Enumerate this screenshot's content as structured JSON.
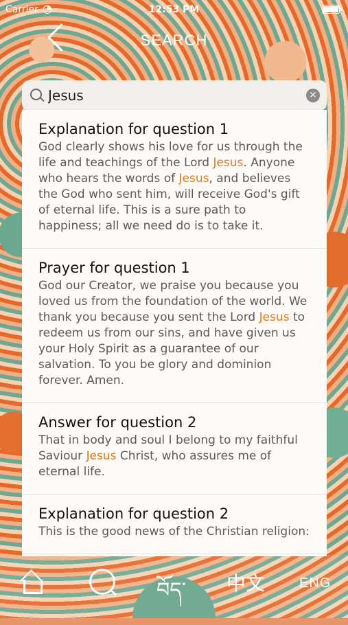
{
  "status_bar": {
    "carrier": "Carrier",
    "time": "12:53 PM"
  },
  "nav": {
    "title": "SEARCH"
  },
  "search": {
    "value": "Jesus",
    "placeholder": ""
  },
  "results": [
    {
      "title": "Explanation for question 1",
      "segments": [
        {
          "text": "God clearly shows his love for us through the life and teachings of the Lord ",
          "hl": false
        },
        {
          "text": "Jesus",
          "hl": true
        },
        {
          "text": ". Anyone who hears the words of ",
          "hl": false
        },
        {
          "text": "Jesus",
          "hl": true
        },
        {
          "text": ", and believes the God who sent him, will receive God's gift of eternal life. This is a sure path to happiness; all we need do is to take it.",
          "hl": false
        }
      ]
    },
    {
      "title": "Prayer for question 1",
      "segments": [
        {
          "text": "God our Creator, we praise you because you loved us from the foundation of the world. We thank you because you sent the Lord ",
          "hl": false
        },
        {
          "text": "Jesus",
          "hl": true
        },
        {
          "text": " to redeem us from our sins, and have given us your Holy Spirit as a guarantee of our salvation. To you be glory and dominion forever. Amen.",
          "hl": false
        }
      ]
    },
    {
      "title": "Answer for question 2",
      "segments": [
        {
          "text": "That in body and soul I belong to my faithful Saviour ",
          "hl": false
        },
        {
          "text": "Jesus",
          "hl": true
        },
        {
          "text": " Christ, who assures me of eternal life.",
          "hl": false
        }
      ]
    },
    {
      "title": "Explanation for question 2",
      "segments": [
        {
          "text": "This is the good news of the Christian religion:",
          "hl": false
        }
      ]
    }
  ],
  "tabbar": {
    "tibetan_label": "བོད་",
    "chinese_label": "中文",
    "english_label": "ENG"
  },
  "colors": {
    "highlight": "#e07a1f",
    "card": "#fdfaf7"
  }
}
